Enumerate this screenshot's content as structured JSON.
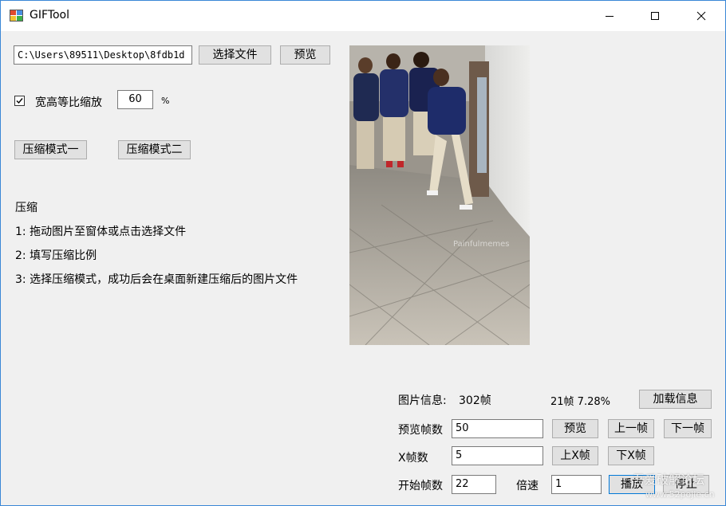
{
  "window": {
    "title": "GIFTool",
    "minimize_icon": "minimize-icon",
    "maximize_icon": "maximize-icon",
    "close_icon": "close-icon"
  },
  "file": {
    "path_value": "C:\\Users\\89511\\Desktop\\8fdb1d",
    "choose_label": "选择文件",
    "preview_label": "预览"
  },
  "scale": {
    "checkbox_label": "宽高等比缩放",
    "checked": true,
    "percent_value": "60",
    "percent_unit": "%"
  },
  "modes": {
    "mode1_label": "压缩模式一",
    "mode2_label": "压缩模式二"
  },
  "instructions": {
    "heading": "压缩",
    "step1": "1: 拖动图片至窗体或点击选择文件",
    "step2": "2: 填写压缩比例",
    "step3": "3: 选择压缩模式，成功后会在桌面新建压缩后的图片文件"
  },
  "image_preview": {
    "watermark": "Painfulmemes"
  },
  "info": {
    "label": "图片信息:",
    "frames": "302帧",
    "current": "21帧 7.28%",
    "load_button": "加载信息"
  },
  "controls": {
    "preview_frames_label": "预览帧数",
    "preview_frames_value": "50",
    "preview_button": "预览",
    "prev_frame_button": "上一帧",
    "next_frame_button": "下一帧",
    "x_frames_label": "X帧数",
    "x_frames_value": "5",
    "prev_x_button": "上X帧",
    "next_x_button": "下X帧",
    "start_frame_label": "开始帧数",
    "start_frame_value": "22",
    "speed_label": "倍速",
    "speed_value": "1",
    "play_button": "播放",
    "stop_button": "停止"
  },
  "site_watermark": {
    "text": "吾爱破解论坛",
    "url": "www.52pojie.cn"
  },
  "colors": {
    "window_border": "#3a87d6",
    "focus_border": "#0078d7",
    "button_bg": "#e1e1e1"
  }
}
